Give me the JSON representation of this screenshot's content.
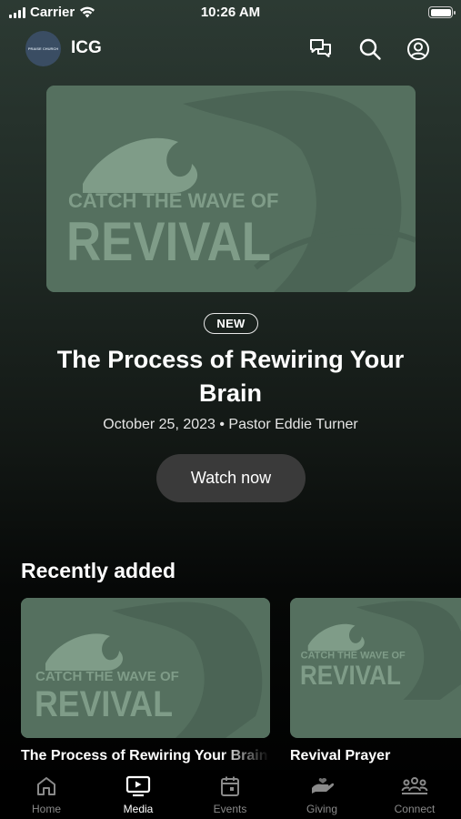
{
  "status_bar": {
    "carrier": "Carrier",
    "time": "10:26 AM"
  },
  "header": {
    "logo_text": "PRAISE CHURCH",
    "title": "ICG",
    "icons": [
      "chat-icon",
      "search-icon",
      "profile-icon"
    ]
  },
  "artwork": {
    "line1": "CATCH THE WAVE OF",
    "line2": "REVIVAL"
  },
  "hero": {
    "badge": "NEW",
    "title": "The Process of Rewiring Your Brain",
    "meta": "October 25, 2023 • Pastor Eddie Turner",
    "button": "Watch now"
  },
  "recent": {
    "title": "Recently added",
    "items": [
      {
        "title": "The Process of Rewiring Your Brain"
      },
      {
        "title": "Revival Prayer"
      }
    ]
  },
  "tabs": [
    {
      "label": "Home",
      "icon": "home-icon"
    },
    {
      "label": "Media",
      "icon": "tv-icon"
    },
    {
      "label": "Events",
      "icon": "calendar-icon"
    },
    {
      "label": "Giving",
      "icon": "giving-icon"
    },
    {
      "label": "Connect",
      "icon": "group-icon"
    }
  ],
  "colors": {
    "accent": "#ffffff",
    "artwork_bg": "#55705f",
    "artwork_fg": "#7f9c88",
    "button_bg": "#3a3a3a"
  }
}
